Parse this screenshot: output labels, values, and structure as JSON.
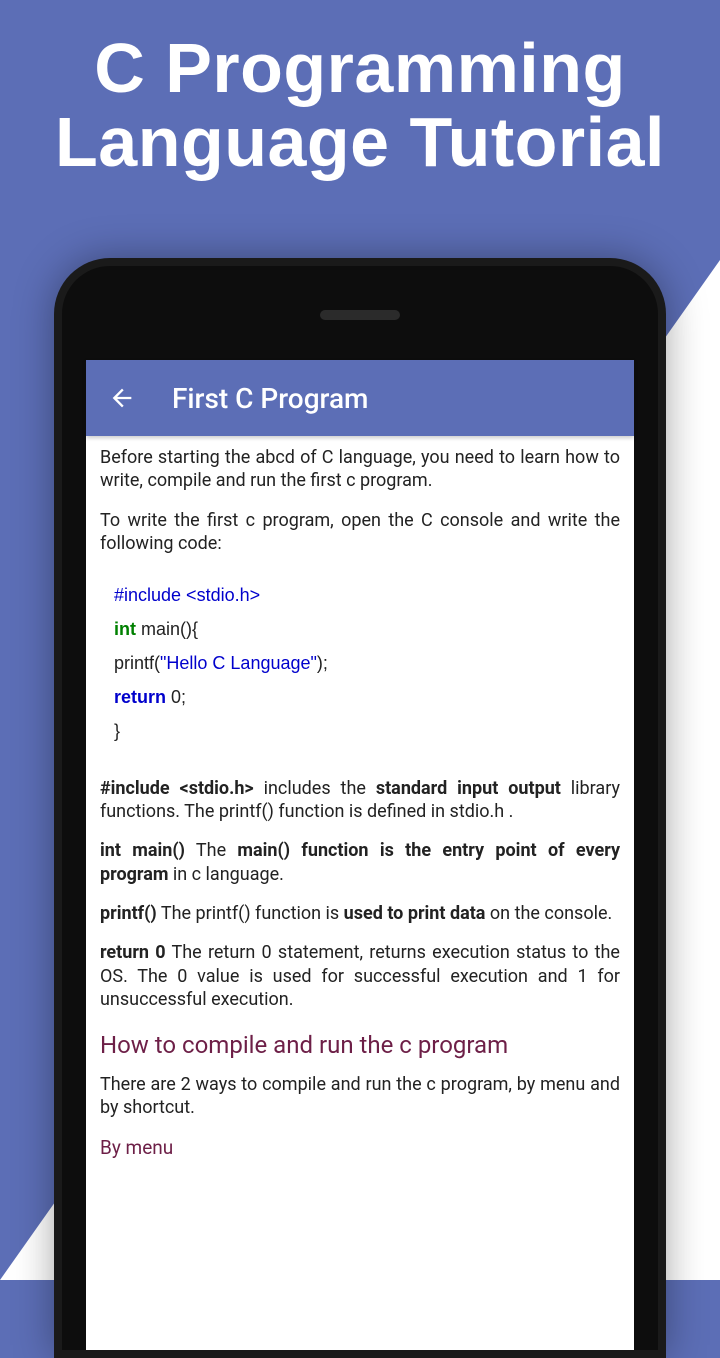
{
  "promo": {
    "line1": "C Programming",
    "line2": "Language Tutorial"
  },
  "appbar": {
    "title": "First C Program"
  },
  "content": {
    "intro1": "Before starting the abcd of C language, you need to learn how to write, compile and run the first c program.",
    "intro2": "To write the first c program, open the C console and write the following code:",
    "code": {
      "l1_a": "#include <stdio.h>",
      "l2_a": "int",
      "l2_b": " main(){",
      "l3_a": "printf(",
      "l3_b": "\"Hello C Language\"",
      "l3_c": ");",
      "l4_a": "return",
      "l4_b": " 0;",
      "l5_a": "}"
    },
    "d1_b1": "#include <stdio.h>",
    "d1_t1": " includes the ",
    "d1_b2": "standard input output",
    "d1_t2": " library functions. The printf() function is defined in stdio.h .",
    "d2_b1": "int main()",
    "d2_t1": " The ",
    "d2_b2": "main() function is the entry point of every program",
    "d2_t2": " in c language.",
    "d3_b1": "printf()",
    "d3_t1": " The printf() function is ",
    "d3_b2": "used to print data",
    "d3_t2": " on the console.",
    "d4_b1": "return 0",
    "d4_t1": " The return 0 statement, returns execution status to the OS. The 0 value is used for successful execution and 1 for unsuccessful execution.",
    "howto_head": "How to compile and run the c program",
    "howto_p1": "There are 2 ways to compile and run the c program, by menu and by shortcut.",
    "bymenu": "By menu"
  }
}
